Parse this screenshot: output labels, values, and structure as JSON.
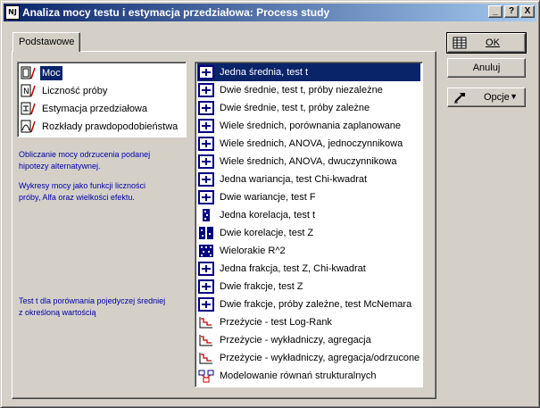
{
  "window": {
    "title": "Analiza mocy testu i estymacja przedziałowa: Process study",
    "icon_text": "NJ",
    "controls": [
      "_",
      "?",
      "X"
    ]
  },
  "tab": {
    "label": "Podstawowe"
  },
  "left_list": [
    {
      "label": "Moc",
      "icon": "power-icon",
      "selected": true
    },
    {
      "label": "Liczność próby",
      "icon": "sample-size-icon",
      "selected": false
    },
    {
      "label": "Estymacja przedziałowa",
      "icon": "interval-icon",
      "selected": false
    },
    {
      "label": "Rozkłady prawdopodobieństwa",
      "icon": "distribution-icon",
      "selected": false
    }
  ],
  "descriptions": {
    "line1": "Obliczanie mocy odrzucenia podanej",
    "line2": "hipotezy alternatywnej.",
    "line3": "Wykresy mocy jako funkcji liczności",
    "line4": "próby, Alfa oraz wielkości efektu.",
    "line5": "Test t dla porównania pojedyczej średniej",
    "line6": "z określoną wartością"
  },
  "right_list": [
    {
      "label": "Jedna średnia, test t",
      "icon": "one-mean-icon",
      "selected": true
    },
    {
      "label": "Dwie średnie, test t, próby niezależne",
      "icon": "two-means-indep-icon",
      "selected": false
    },
    {
      "label": "Dwie średnie, test t, próby zależne",
      "icon": "two-means-dep-icon",
      "selected": false
    },
    {
      "label": "Wiele średnich, porównania zaplanowane",
      "icon": "planned-comparisons-icon",
      "selected": false
    },
    {
      "label": "Wiele średnich, ANOVA, jednoczynnikowa",
      "icon": "anova-one-icon",
      "selected": false
    },
    {
      "label": "Wiele średnich, ANOVA, dwuczynnikowa",
      "icon": "anova-two-icon",
      "selected": false
    },
    {
      "label": "Jedna wariancja, test Chi-kwadrat",
      "icon": "one-variance-icon",
      "selected": false
    },
    {
      "label": "Dwie wariancje, test F",
      "icon": "two-variances-icon",
      "selected": false
    },
    {
      "label": "Jedna korelacja, test t",
      "icon": "one-correlation-icon",
      "selected": false
    },
    {
      "label": "Dwie korelacje, test Z",
      "icon": "two-correlations-icon",
      "selected": false
    },
    {
      "label": "Wielorakie R^2",
      "icon": "multiple-r2-icon",
      "selected": false
    },
    {
      "label": "Jedna frakcja, test Z, Chi-kwadrat",
      "icon": "one-proportion-icon",
      "selected": false
    },
    {
      "label": "Dwie frakcje, test Z",
      "icon": "two-proportions-icon",
      "selected": false
    },
    {
      "label": "Dwie frakcje, próby zależne, test McNemara",
      "icon": "mcnemar-icon",
      "selected": false
    },
    {
      "label": "Przeżycie - test Log-Rank",
      "icon": "survival-icon",
      "selected": false
    },
    {
      "label": "Przeżycie - wykładniczy, agregacja",
      "icon": "survival-icon",
      "selected": false
    },
    {
      "label": "Przeżycie - wykładniczy, agregacja/odrzucone",
      "icon": "survival-icon",
      "selected": false
    },
    {
      "label": "Modelowanie równań strukturalnych",
      "icon": "sem-icon",
      "selected": false
    }
  ],
  "buttons": {
    "ok": "OK",
    "cancel": "Anuluj",
    "options": "Opcje"
  },
  "colors": {
    "selection": "#0a246a",
    "description_text": "#0000a8",
    "face": "#d4d0c8"
  }
}
